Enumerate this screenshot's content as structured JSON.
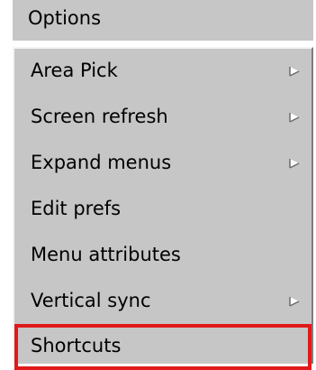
{
  "menu": {
    "title": "Options",
    "items": [
      {
        "label": "Area Pick",
        "has_submenu": true
      },
      {
        "label": "Screen refresh",
        "has_submenu": true
      },
      {
        "label": "Expand menus",
        "has_submenu": true
      },
      {
        "label": "Edit prefs",
        "has_submenu": false
      },
      {
        "label": "Menu attributes",
        "has_submenu": false
      },
      {
        "label": "Vertical sync",
        "has_submenu": true
      },
      {
        "label": "Shortcuts",
        "has_submenu": false,
        "highlighted": true
      }
    ]
  },
  "colors": {
    "menu_bg": "#c6c6c6",
    "highlight_border": "#e01a1a",
    "text": "#000000"
  },
  "icons": {
    "submenu": "submenu-arrow-icon"
  }
}
